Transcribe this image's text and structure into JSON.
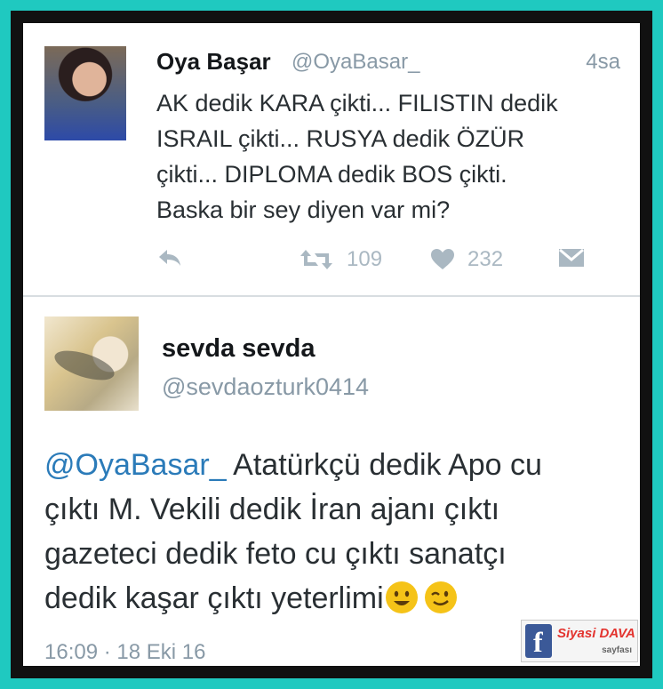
{
  "tweet1": {
    "name": "Oya Başar",
    "handle": "@OyaBasar_",
    "time": "4sa",
    "lines": [
      "AK dedik KARA çikti... FILISTIN dedik",
      "ISRAIL çikti... RUSYA dedik ÖZÜR",
      "çikti... DIPLOMA dedik BOS çikti.",
      "Baska bir sey diyen var mi?"
    ],
    "retweets": "109",
    "likes": "232"
  },
  "tweet2": {
    "name": "sevda sevda",
    "handle": "@sevdaozturk0414",
    "mention": "@OyaBasar_",
    "lines": [
      " Atatürkçü dedik Apo cu",
      "çıktı M. Vekili dedik İran ajanı çıktı",
      "gazeteci dedik feto cu çıktı sanatçı",
      "dedik kaşar çıktı yeterlimi"
    ],
    "date": "16:09 · 18 Eki 16"
  },
  "watermark": {
    "logo_letter": "f",
    "title": "Siyasi DAVA",
    "subtitle": "sayfası"
  },
  "colors": {
    "frame": "#1fc9c0",
    "mention": "#2b7bb9",
    "muted": "#8899a6"
  }
}
